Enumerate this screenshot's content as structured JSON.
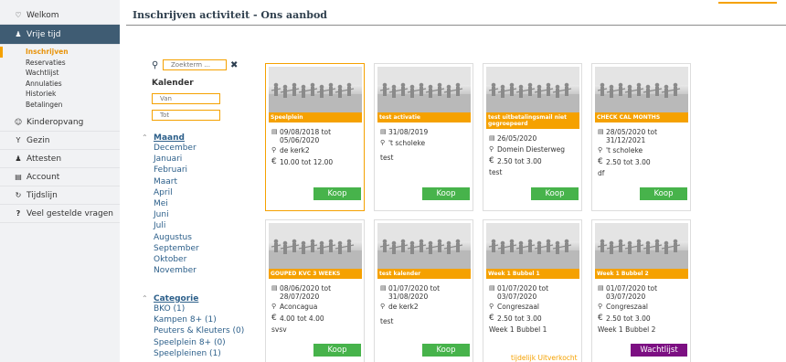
{
  "sidebar": {
    "items": [
      {
        "label": "Welkom",
        "icon": "welcome-icon",
        "glyph": "♡"
      },
      {
        "label": "Vrije tijd",
        "icon": "leisure-icon",
        "glyph": "♟"
      },
      {
        "label": "Kinderopvang",
        "icon": "childcare-icon",
        "glyph": "☺"
      },
      {
        "label": "Gezin",
        "icon": "family-icon",
        "glyph": "Y"
      },
      {
        "label": "Attesten",
        "icon": "user-icon",
        "glyph": "♟"
      },
      {
        "label": "Account",
        "icon": "account-icon",
        "glyph": "▤"
      },
      {
        "label": "Tijdslijn",
        "icon": "history-icon",
        "glyph": "↻"
      },
      {
        "label": "Veel gestelde vragen",
        "icon": "question-icon",
        "glyph": "?"
      }
    ],
    "sub_items": [
      "Inschrijven",
      "Reservaties",
      "Wachtlijst",
      "Annulaties",
      "Historiek",
      "Betalingen"
    ]
  },
  "header": {
    "title": "Inschrijven activiteit - Ons aanbod"
  },
  "filters": {
    "search_placeholder": "Zoekterm ...",
    "kalender_label": "Kalender",
    "van_placeholder": "Van",
    "tot_placeholder": "Tot",
    "maand_label": "Maand",
    "months": [
      "December",
      "Januari",
      "Februari",
      "Maart",
      "April",
      "Mei",
      "Juni",
      "Juli",
      "Augustus",
      "September",
      "Oktober",
      "November"
    ],
    "categorie_label": "Categorie",
    "categories": [
      "BKO (1)",
      "Kampen 8+ (1)",
      "Peuters & Kleuters (0)",
      "Speelplein 8+ (0)",
      "Speelpleinen (1)"
    ]
  },
  "cards": [
    {
      "title": "Speelplein",
      "date": "09/08/2018 tot 05/06/2020",
      "location": "de kerk2",
      "price": "10.00 tot 12.00",
      "desc": "",
      "button": "Koop",
      "note": ""
    },
    {
      "title": "test activatie",
      "date": "31/08/2019",
      "location": "'t scholeke",
      "price": "",
      "desc": "test",
      "button": "Koop",
      "note": ""
    },
    {
      "title": "test uitbetalingsmail niet gegroepeerd",
      "date": "26/05/2020",
      "location": "Domein Diesterweg",
      "price": "2.50 tot 3.00",
      "desc": "test",
      "button": "Koop",
      "note": ""
    },
    {
      "title": "CHECK CAL MONTHS",
      "date": "28/05/2020 tot 31/12/2021",
      "location": "'t scholeke",
      "price": "2.50 tot 3.00",
      "desc": "df",
      "button": "Koop",
      "note": ""
    },
    {
      "title": "GOUPED KVC 3 WEEKS",
      "date": "08/06/2020 tot 28/07/2020",
      "location": "Aconcagua",
      "price": "4.00 tot 4.00",
      "desc": "svsv",
      "button": "Koop",
      "note": ""
    },
    {
      "title": "test kalender",
      "date": "01/07/2020 tot 31/08/2020",
      "location": "de kerk2",
      "price": "",
      "desc": "test",
      "button": "Koop",
      "note": ""
    },
    {
      "title": "Week 1 Bubbel 1",
      "date": "01/07/2020 tot 03/07/2020",
      "location": "Congreszaal",
      "price": "2.50 tot 3.00",
      "desc": "Week 1 Bubbel 1",
      "button": "",
      "note": "tijdelijk Uitverkocht"
    },
    {
      "title": "Week 1 Bubbel 2",
      "date": "01/07/2020 tot 03/07/2020",
      "location": "Congreszaal",
      "price": "2.50 tot 3.00",
      "desc": "Week 1 Bubbel 2",
      "button": "Wachtlijst",
      "note": ""
    }
  ],
  "colors": {
    "accent": "#f5a100",
    "nav_active": "#3f5c73",
    "buy": "#47b34b",
    "waitlist": "#7c0f82"
  }
}
